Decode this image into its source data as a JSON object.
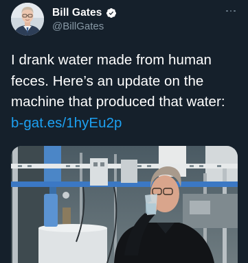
{
  "author": {
    "display_name": "Bill Gates",
    "handle": "@BillGates",
    "verified": true,
    "avatar_icon": "profile-photo"
  },
  "menu": {
    "more_icon": "more-horizontal-icon"
  },
  "tweet": {
    "lines": [
      "I drank water made from human",
      "feces. Here’s an update on the",
      "machine that produced that water:"
    ],
    "link": "b-gat.es/1hyEu2p"
  },
  "media": {
    "type": "photo"
  },
  "colors": {
    "background": "#15202b",
    "text": "#ffffff",
    "secondary_text": "#8899a6",
    "link": "#1da1f2",
    "verified_badge": "#ffffff"
  }
}
